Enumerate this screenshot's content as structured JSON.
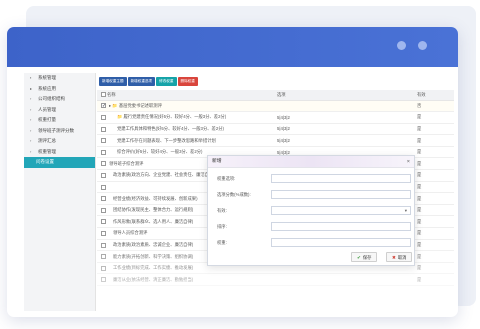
{
  "sidebar": {
    "items": [
      {
        "icon": "bullet",
        "label": "系统管理"
      },
      {
        "icon": "folder",
        "label": "系统应用"
      },
      {
        "icon": "chevron",
        "label": "公司组织结构"
      },
      {
        "icon": "chevron",
        "label": "人员管理"
      },
      {
        "icon": "chevron",
        "label": "权重打量"
      },
      {
        "icon": "chevron",
        "label": "领导班子测评分数"
      },
      {
        "icon": "chevron",
        "label": "测评汇总"
      },
      {
        "icon": "chevron",
        "label": "权重管理"
      },
      {
        "icon": "none",
        "label": "问卷设置",
        "active": true
      }
    ]
  },
  "toolbar": {
    "buttons": [
      "新增权重主题",
      "新增权重选项",
      "修改权重",
      "删除权重"
    ]
  },
  "table": {
    "headers": [
      "",
      "名称",
      "选项",
      "有效"
    ],
    "rows": [
      {
        "checked": true,
        "name": "▸ 📁 基层党委书记述职测评",
        "score": "",
        "valid": "否"
      },
      {
        "checked": false,
        "name": "📁 履行党建责任情况(好5分、较好4分、一般3分、差2分)",
        "score": "5|4|3|2",
        "valid": "是"
      },
      {
        "checked": false,
        "name": "党建工作具体和特色(好5分、较好4分、一般3分、差2分)",
        "score": "5|4|3|2",
        "valid": "是"
      },
      {
        "checked": false,
        "name": "党建工作存在问题表现、下一步整改思路和举措计划",
        "score": "5|4|3|2",
        "valid": "是"
      },
      {
        "checked": false,
        "name": "综合评价(好5分、较好4分、一般3分、差2分)",
        "score": "5|4|3|2",
        "valid": "是"
      },
      {
        "checked": false,
        "name": "领导班子综合测评",
        "score": "",
        "valid": "是"
      },
      {
        "checked": false,
        "name": "政治素质(政治方向、企业党建、社会责任、廉洁自律)",
        "score": "",
        "valid": "是"
      },
      {
        "checked": false,
        "name": "",
        "score": "",
        "valid": "是"
      },
      {
        "checked": false,
        "name": "经营业绩(经济效益、可持续发展、创新成果)",
        "score": "",
        "valid": "是"
      },
      {
        "checked": false,
        "name": "团结协作(发现民主、整体合力、运行规则)",
        "score": "",
        "valid": "是"
      },
      {
        "checked": false,
        "name": "作风形象(联系群众、选人用人、廉洁自律)",
        "score": "",
        "valid": "是"
      },
      {
        "checked": false,
        "name": "领导人员综合测评",
        "score": "",
        "valid": "是"
      },
      {
        "checked": false,
        "name": "政治素质(政治素质、忠诚企业、廉洁自律)",
        "score": "",
        "valid": "是"
      },
      {
        "checked": false,
        "name": "能力素质(开拓创新、科学决策、组织协调)",
        "score": "",
        "valid": "是"
      },
      {
        "checked": false,
        "name": "工作业绩(目标完成、工作实绩、推动发展)",
        "score": "",
        "valid": "是"
      },
      {
        "checked": false,
        "name": "廉洁从业(依法经营、清正廉洁、勤勉担当)",
        "score": "",
        "valid": "是"
      }
    ]
  },
  "dialog": {
    "title": "新增",
    "close_glyph": "×",
    "fields": [
      {
        "label": "权重选项:",
        "type": "text",
        "value": ""
      },
      {
        "label": "选项分数(%或数):",
        "type": "text",
        "value": ""
      },
      {
        "label": "有效:",
        "type": "select",
        "value": ""
      },
      {
        "label": "排序:",
        "type": "text",
        "value": ""
      },
      {
        "label": "权重:",
        "type": "text",
        "value": ""
      }
    ],
    "save_label": "保存",
    "cancel_label": "取消"
  }
}
